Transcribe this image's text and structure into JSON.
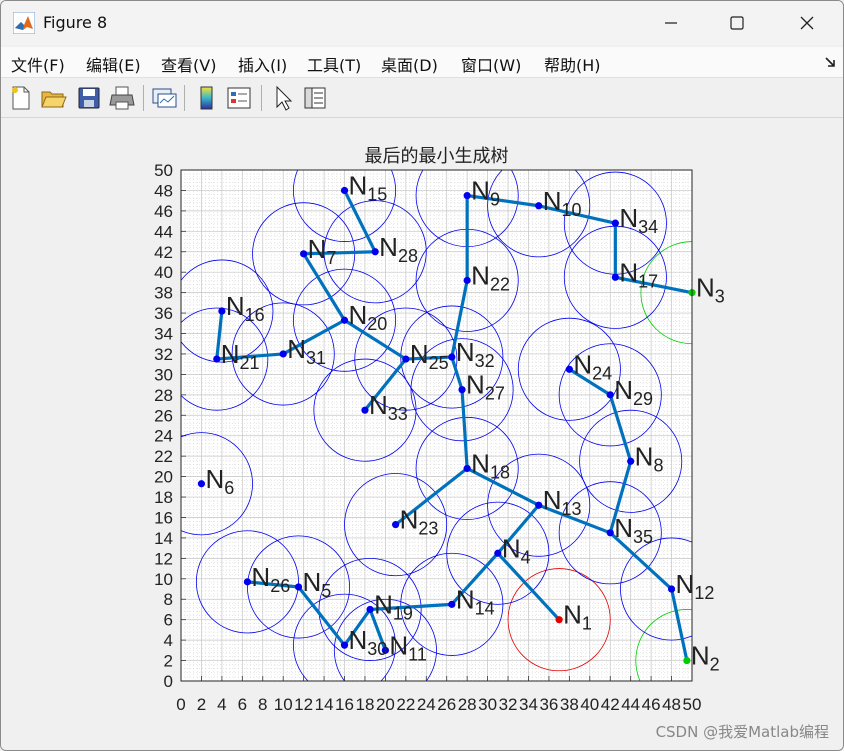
{
  "window": {
    "title": "Figure 8"
  },
  "menu": [
    "文件(F)",
    "编辑(E)",
    "查看(V)",
    "插入(I)",
    "工具(T)",
    "桌面(D)",
    "窗口(W)",
    "帮助(H)"
  ],
  "toolbar": [
    "new-figure",
    "open-file",
    "save",
    "print",
    "link-plot",
    "insert-colorbar",
    "insert-legend",
    "edit-plot",
    "property-inspector"
  ],
  "watermark": "CSDN @我爱Matlab编程",
  "chart_data": {
    "type": "scatter",
    "title": "最后的最小生成树",
    "xlim": [
      0,
      50
    ],
    "ylim": [
      0,
      50
    ],
    "xticks": [
      0,
      2,
      4,
      6,
      8,
      10,
      12,
      14,
      16,
      18,
      20,
      22,
      24,
      26,
      28,
      30,
      32,
      34,
      36,
      38,
      40,
      42,
      44,
      46,
      48,
      50
    ],
    "yticks": [
      0,
      2,
      4,
      6,
      8,
      10,
      12,
      14,
      16,
      18,
      20,
      22,
      24,
      26,
      28,
      30,
      32,
      34,
      36,
      38,
      40,
      42,
      44,
      46,
      48,
      50
    ],
    "grid": true,
    "circle_radius": 5,
    "nodes": [
      {
        "id": "1",
        "x": 37,
        "y": 6,
        "color": "#e00000"
      },
      {
        "id": "2",
        "x": 49.5,
        "y": 2,
        "color": "#00cc00"
      },
      {
        "id": "3",
        "x": 50,
        "y": 38,
        "color": "#00cc00"
      },
      {
        "id": "4",
        "x": 31,
        "y": 12.5,
        "color": "#0000ee"
      },
      {
        "id": "5",
        "x": 11.5,
        "y": 9.2,
        "color": "#0000ee"
      },
      {
        "id": "6",
        "x": 2,
        "y": 19.3,
        "color": "#0000ee"
      },
      {
        "id": "7",
        "x": 12,
        "y": 41.8,
        "color": "#0000ee"
      },
      {
        "id": "8",
        "x": 44,
        "y": 21.5,
        "color": "#0000ee"
      },
      {
        "id": "9",
        "x": 28,
        "y": 47.5,
        "color": "#0000ee"
      },
      {
        "id": "10",
        "x": 35,
        "y": 46.5,
        "color": "#0000ee"
      },
      {
        "id": "11",
        "x": 20,
        "y": 3,
        "color": "#0000ee"
      },
      {
        "id": "12",
        "x": 48,
        "y": 9,
        "color": "#0000ee"
      },
      {
        "id": "13",
        "x": 35,
        "y": 17.2,
        "color": "#0000ee"
      },
      {
        "id": "14",
        "x": 26.5,
        "y": 7.5,
        "color": "#0000ee"
      },
      {
        "id": "15",
        "x": 16,
        "y": 48,
        "color": "#0000ee"
      },
      {
        "id": "16",
        "x": 4,
        "y": 36.2,
        "color": "#0000ee"
      },
      {
        "id": "17",
        "x": 42.5,
        "y": 39.5,
        "color": "#0000ee"
      },
      {
        "id": "18",
        "x": 28,
        "y": 20.8,
        "color": "#0000ee"
      },
      {
        "id": "19",
        "x": 18.5,
        "y": 7,
        "color": "#0000ee"
      },
      {
        "id": "20",
        "x": 16,
        "y": 35.3,
        "color": "#0000ee"
      },
      {
        "id": "21",
        "x": 3.5,
        "y": 31.5,
        "color": "#0000ee"
      },
      {
        "id": "22",
        "x": 28,
        "y": 39.2,
        "color": "#0000ee"
      },
      {
        "id": "23",
        "x": 21,
        "y": 15.3,
        "color": "#0000ee"
      },
      {
        "id": "24",
        "x": 38,
        "y": 30.5,
        "color": "#0000ee"
      },
      {
        "id": "25",
        "x": 22,
        "y": 31.5,
        "color": "#0000ee"
      },
      {
        "id": "26",
        "x": 6.5,
        "y": 9.7,
        "color": "#0000ee"
      },
      {
        "id": "27",
        "x": 27.5,
        "y": 28.5,
        "color": "#0000ee"
      },
      {
        "id": "28",
        "x": 19,
        "y": 42,
        "color": "#0000ee"
      },
      {
        "id": "29",
        "x": 42,
        "y": 28,
        "color": "#0000ee"
      },
      {
        "id": "30",
        "x": 16,
        "y": 3.5,
        "color": "#0000ee"
      },
      {
        "id": "31",
        "x": 10,
        "y": 32,
        "color": "#0000ee"
      },
      {
        "id": "32",
        "x": 26.5,
        "y": 31.7,
        "color": "#0000ee"
      },
      {
        "id": "33",
        "x": 18,
        "y": 26.5,
        "color": "#0000ee"
      },
      {
        "id": "34",
        "x": 42.5,
        "y": 44.8,
        "color": "#0000ee"
      },
      {
        "id": "35",
        "x": 42,
        "y": 14.5,
        "color": "#0000ee"
      }
    ],
    "node_label_prefix": "N",
    "edges": [
      [
        "1",
        "4"
      ],
      [
        "4",
        "14"
      ],
      [
        "14",
        "19"
      ],
      [
        "19",
        "11"
      ],
      [
        "19",
        "30"
      ],
      [
        "30",
        "5"
      ],
      [
        "5",
        "26"
      ],
      [
        "4",
        "13"
      ],
      [
        "13",
        "18"
      ],
      [
        "18",
        "23"
      ],
      [
        "18",
        "27"
      ],
      [
        "27",
        "32"
      ],
      [
        "32",
        "22"
      ],
      [
        "22",
        "9"
      ],
      [
        "9",
        "10"
      ],
      [
        "10",
        "34"
      ],
      [
        "34",
        "17"
      ],
      [
        "17",
        "3"
      ],
      [
        "32",
        "25"
      ],
      [
        "25",
        "33"
      ],
      [
        "25",
        "20"
      ],
      [
        "20",
        "31"
      ],
      [
        "31",
        "21"
      ],
      [
        "21",
        "16"
      ],
      [
        "20",
        "7"
      ],
      [
        "7",
        "28"
      ],
      [
        "28",
        "15"
      ],
      [
        "13",
        "35"
      ],
      [
        "35",
        "8"
      ],
      [
        "8",
        "29"
      ],
      [
        "29",
        "24"
      ],
      [
        "35",
        "12"
      ],
      [
        "12",
        "2"
      ]
    ]
  }
}
